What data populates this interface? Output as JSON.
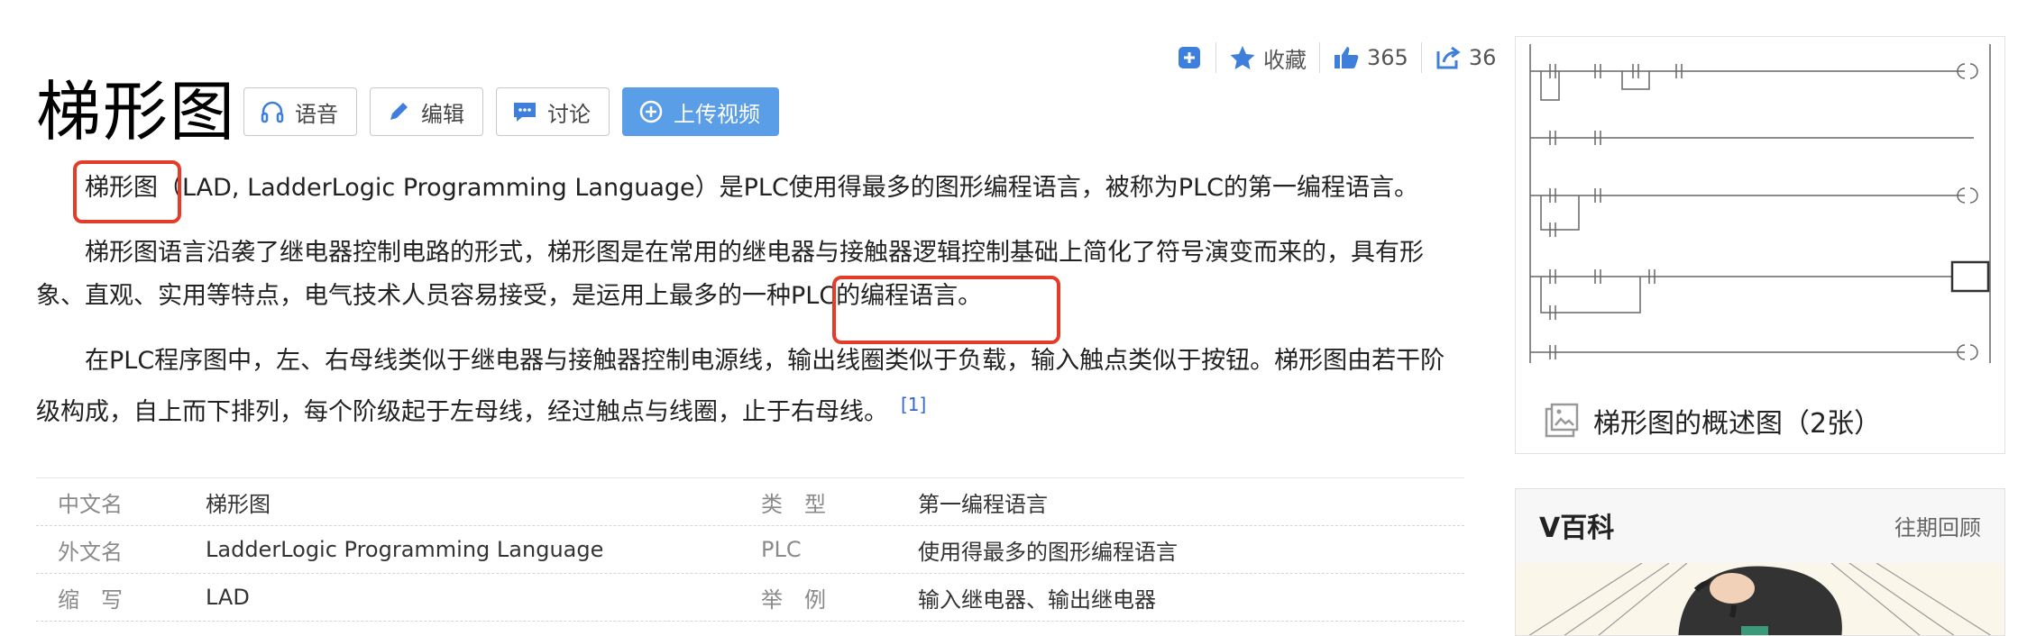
{
  "actions": {
    "favorite_label": "收藏",
    "like_count": "365",
    "share_count": "36"
  },
  "title": "梯形图",
  "buttons": {
    "voice": "语音",
    "edit": "编辑",
    "discuss": "讨论",
    "upload": "上传视频"
  },
  "paragraphs": {
    "p1_term": "梯形图",
    "p1_rest": "（LAD, LadderLogic Programming Language）是PLC使用得最多的图形编程语言，被称为PLC的第一编程语言。",
    "p2": "梯形图语言沿袭了继电器控制电路的形式，梯形图是在常用的继电器与接触器逻辑控制基础上简化了符号演变而来的，具有形象、直观、实用等特点，电气技术人员容易接受，是运用上最多的一种PLC的编程语言。",
    "p3": "在PLC程序图中，左、右母线类似于继电器与接触器控制电源线，输出线圈类似于负载，输入触点类似于按钮。梯形图由若干阶级构成，自上而下排列，每个阶级起于左母线，经过触点与线圈，止于右母线。",
    "p3_ref": "[1]"
  },
  "info_table": [
    {
      "k1": "中文名",
      "v1": "梯形图",
      "k2": "类　型",
      "v2": "第一编程语言"
    },
    {
      "k1": "外文名",
      "v1": "LadderLogic Programming Language",
      "k2": "PLC",
      "v2": "使用得最多的图形编程语言"
    },
    {
      "k1": "缩　写",
      "v1": "LAD",
      "k2": "举　例",
      "v2": "输入继电器、输出继电器"
    }
  ],
  "image_card": {
    "caption": "梯形图的概述图（2张）"
  },
  "vbaike": {
    "title": "V百科",
    "more": "往期回顾"
  },
  "colors": {
    "primary_button": "#5b9ee8",
    "highlight_box": "#e33d2a",
    "link": "#3366cc"
  }
}
